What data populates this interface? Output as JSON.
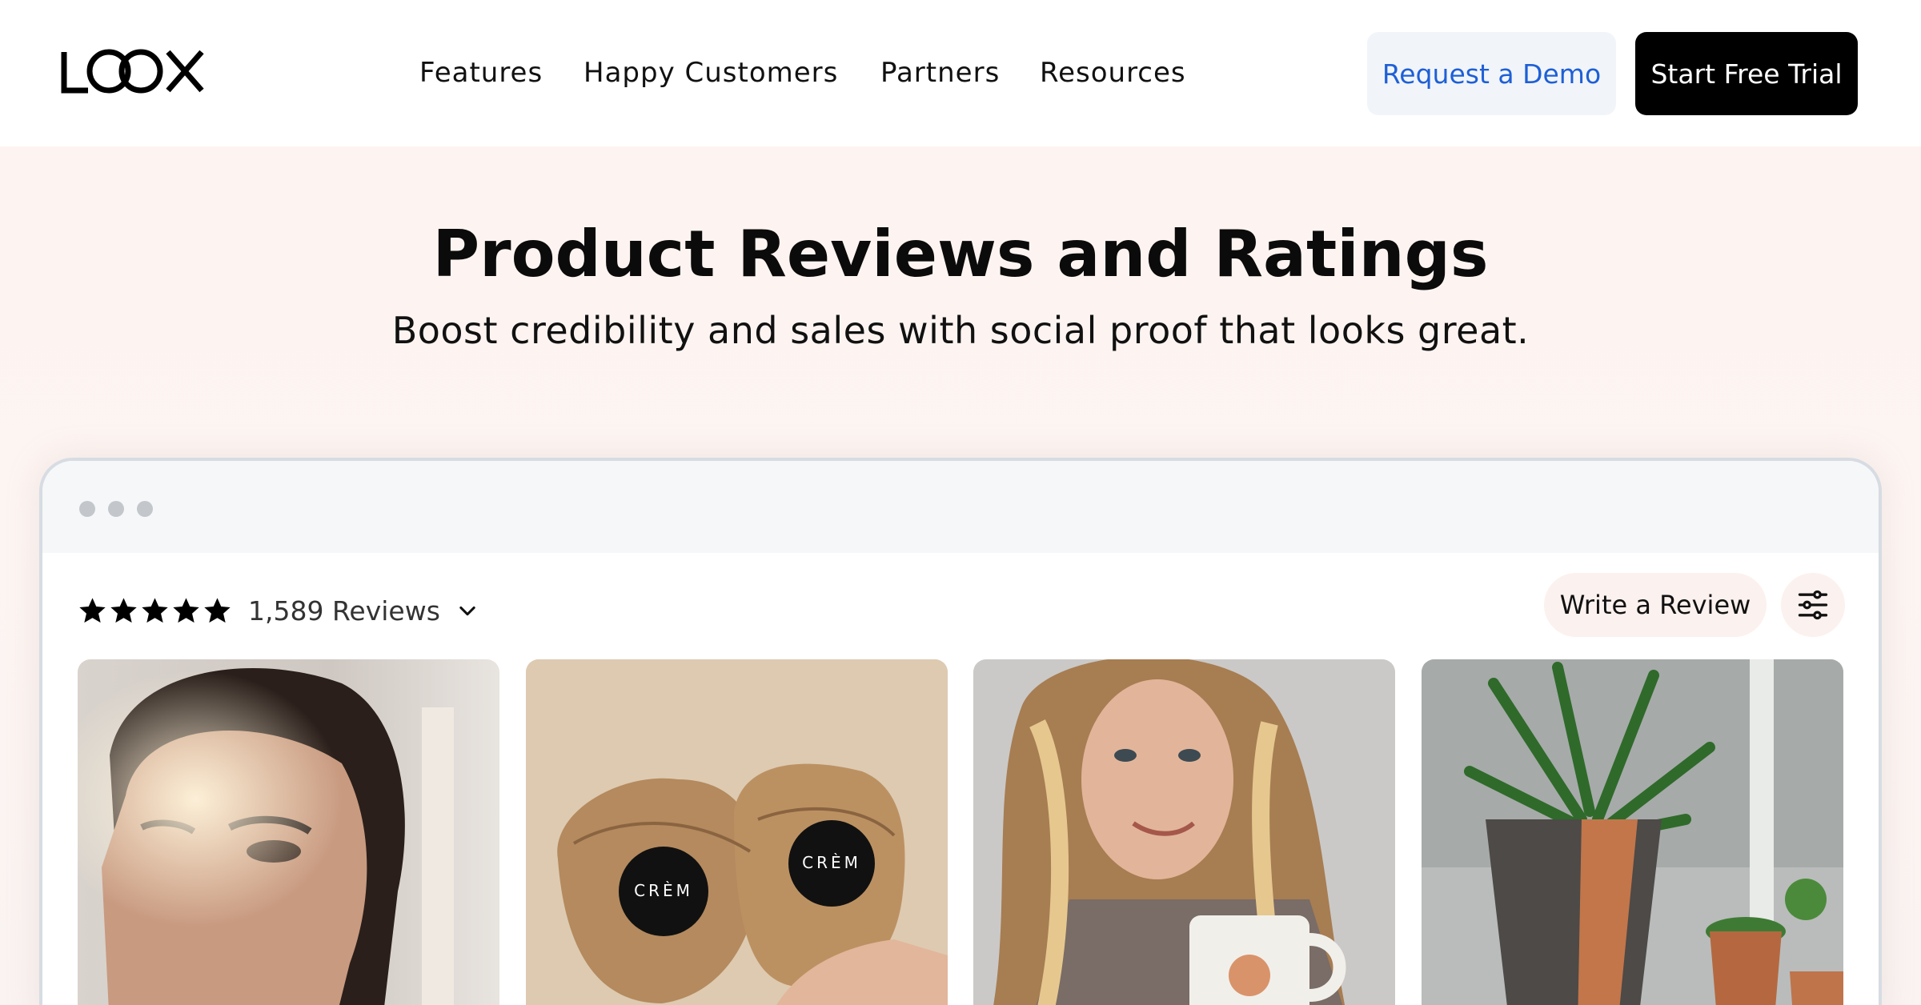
{
  "header": {
    "logo_text": "LOOX",
    "nav": [
      "Features",
      "Happy Customers",
      "Partners",
      "Resources"
    ],
    "request_demo_label": "Request a Demo",
    "start_trial_label": "Start Free Trial"
  },
  "hero": {
    "title": "Product Reviews and Ratings",
    "subtitle": "Boost credibility and sales with social proof that looks great."
  },
  "widget": {
    "stars": 5,
    "review_count": "1,589 Reviews",
    "write_review_label": "Write a Review",
    "filter_icon": "sliders-icon",
    "card_photos": [
      {
        "subject": "woman-closeup-selfie"
      },
      {
        "subject": "wrapped-packages",
        "brand_text": "CRÈM"
      },
      {
        "subject": "woman-with-mug"
      },
      {
        "subject": "potted-plants"
      }
    ]
  },
  "colors": {
    "hero_bg": "#fdf4f1",
    "demo_text": "#1e5fd6",
    "demo_bg": "#f1f5fa",
    "trial_bg": "#000000",
    "pill_bg": "#fbf1ee"
  }
}
